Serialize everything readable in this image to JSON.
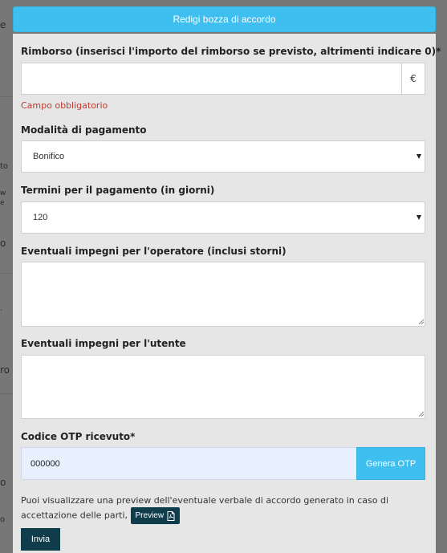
{
  "background": {
    "fragments": [
      "e",
      "to",
      "w",
      "e",
      "o",
      "·",
      "ro",
      "o",
      "o"
    ]
  },
  "header": {
    "button_label": "Redigi bozza di accordo"
  },
  "form": {
    "rimborso": {
      "label": "Rimborso (inserisci l'importo del rimborso se previsto, altrimenti indicare 0)*",
      "value": "",
      "addon": "€",
      "error": "Campo obbligatorio"
    },
    "modalita": {
      "label": "Modalità di pagamento",
      "selected": "Bonifico"
    },
    "termini": {
      "label": "Termini per il pagamento (in giorni)",
      "selected": "120"
    },
    "impegni_operatore": {
      "label": "Eventuali impegni per l'operatore (inclusi storni)",
      "value": ""
    },
    "impegni_utente": {
      "label": "Eventuali impegni per l'utente",
      "value": ""
    },
    "otp": {
      "label": "Codice OTP ricevuto*",
      "value": "000000",
      "button_label": "Genera OTP"
    },
    "note": {
      "text": "Puoi visualizzare una preview dell'eventuale verbale di accordo generato in caso di accettazione delle parti,",
      "preview_label": "Preview"
    },
    "submit_label": "Invia"
  },
  "colors": {
    "accent": "#3fbfef",
    "dark_button": "#0f3d4c",
    "error": "#c0392b",
    "panel": "#e6e6e6"
  }
}
